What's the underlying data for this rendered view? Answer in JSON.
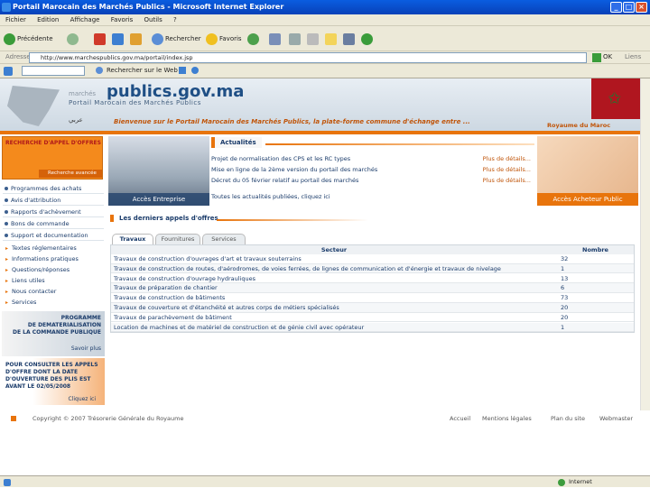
{
  "window": {
    "title": "Portail Marocain des Marchés Publics - Microsoft Internet Explorer"
  },
  "menu": [
    "Fichier",
    "Edition",
    "Affichage",
    "Favoris",
    "Outils",
    "?"
  ],
  "toolbar": {
    "back": "Précédente",
    "search": "Rechercher",
    "favorites": "Favoris"
  },
  "address": {
    "label": "Adresse",
    "url": "http://www.marchespublics.gov.ma/portail/index.jsp",
    "go": "OK",
    "links": "Liens"
  },
  "links_bar": {
    "search_web": "Rechercher sur le Web"
  },
  "site": {
    "logo_small": "marchés",
    "logo_main": "publics.gov.ma",
    "logo_sub": "Portail Marocain des Marchés Publics",
    "arabic": "عربي",
    "welcome": "Bienvenue sur le Portail Marocain des Marchés Publics, la plate-forme commune d'échange entre ...",
    "royaume": "Royaume du Maroc"
  },
  "left": {
    "search_title": "RECHERCHE D'APPEL D'OFFRES",
    "search_btn": "Recherche avancée",
    "nav": [
      "Programmes des achats",
      "Avis d'attribution",
      "Rapports d'achèvement",
      "Bons de commande",
      "Support et documentation"
    ],
    "sub": [
      "Textes réglementaires",
      "Informations pratiques",
      "Questions/réponses",
      "Liens utiles",
      "Nous contacter",
      "Services"
    ],
    "promo1": {
      "text": "PROGRAMME\nDE DEMATERIALISATION\nDE LA COMMANDE PUBLIQUE",
      "more": "Savoir plus"
    },
    "promo2": {
      "text": "POUR CONSULTER LES APPELS\nD'OFFRE DONT LA DATE\nD'OUVERTURE DES PLIS EST\nAVANT LE 02/05/2008",
      "more": "Cliquez ici"
    }
  },
  "acces_entreprise": "Accès Entreprise",
  "acces_acheteur": "Accès Acheteur Public",
  "actualites": {
    "title": "Actualités",
    "items": [
      {
        "text": "Projet de normalisation des CPS et les RC types",
        "more": "Plus de détails..."
      },
      {
        "text": "Mise en ligne de la 2ème version du portail des marchés",
        "more": "Plus de détails..."
      },
      {
        "text": "Décret du 05 février relatif au portail des marchés",
        "more": "Plus de détails..."
      }
    ],
    "all": "Toutes les actualités publiées, cliquez ici"
  },
  "appels": {
    "title": "Les derniers appels d'offres",
    "tabs": [
      "Travaux",
      "Fournitures",
      "Services"
    ],
    "headers": {
      "sector": "Secteur",
      "count": "Nombre"
    },
    "rows": [
      {
        "sector": "Travaux de construction d'ouvrages d'art et travaux souterrains",
        "count": "32"
      },
      {
        "sector": "Travaux de construction de routes, d'aérodromes, de voies ferrées, de lignes de communication et d'énergie et travaux de nivelage",
        "count": "1"
      },
      {
        "sector": "Travaux de construction d'ouvrage hydrauliques",
        "count": "13"
      },
      {
        "sector": "Travaux de préparation de chantier",
        "count": "6"
      },
      {
        "sector": "Travaux de construction de bâtiments",
        "count": "73"
      },
      {
        "sector": "Travaux de couverture et d'étanchéité et autres corps de métiers spécialisés",
        "count": "20"
      },
      {
        "sector": "Travaux de parachèvement de bâtiment",
        "count": "20"
      },
      {
        "sector": "Location de machines et de matériel de construction et de génie civil avec opérateur",
        "count": "1"
      }
    ]
  },
  "footer": {
    "copyright": "Copyright © 2007 Trésorerie Générale du Royaume",
    "links": [
      "Accueil",
      "Mentions légales",
      "Plan du site",
      "Webmaster"
    ]
  },
  "status": {
    "zone": "Internet"
  }
}
